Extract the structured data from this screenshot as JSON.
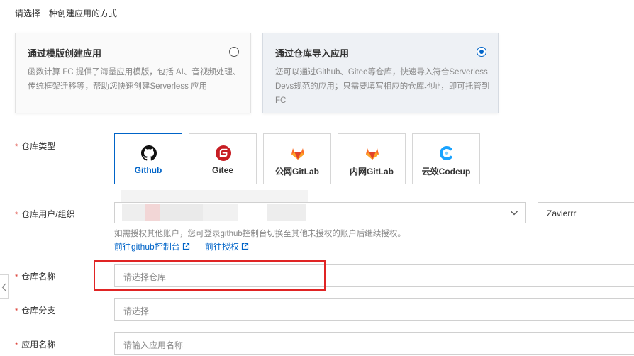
{
  "section_title": "请选择一种创建应用的方式",
  "methods": [
    {
      "title": "通过模版创建应用",
      "description": "函数计算 FC 提供了海量应用模版，包括 AI、音视频处理、传统框架迁移等，帮助您快速创建Serverless 应用",
      "checked": false
    },
    {
      "title": "通过仓库导入应用",
      "description": "您可以通过Github、Gitee等仓库，快速导入符合Serverless Devs规范的应用；只需要填写相应的仓库地址，即可托管到 FC",
      "checked": true
    }
  ],
  "form": {
    "repo_type_label": "仓库类型",
    "repo_types": [
      {
        "name": "Github",
        "icon": "github-icon",
        "selected": true
      },
      {
        "name": "Gitee",
        "icon": "gitee-icon",
        "selected": false
      },
      {
        "name": "公网GitLab",
        "icon": "gitlab-icon",
        "selected": false
      },
      {
        "name": "内网GitLab",
        "icon": "gitlab-icon",
        "selected": false
      },
      {
        "name": "云效Codeup",
        "icon": "codeup-icon",
        "selected": false
      }
    ],
    "owner_label": "仓库用户/组织",
    "owner_value": "Zavierrr",
    "hint": "如需授权其他账户，您可登录github控制台切换至其他未授权的账户后继续授权。",
    "link_console": "前往github控制台",
    "link_authorize": "前往授权",
    "repo_name_label": "仓库名称",
    "repo_name_placeholder": "请选择仓库",
    "branch_label": "仓库分支",
    "branch_placeholder": "请选择",
    "app_name_label": "应用名称",
    "app_name_placeholder": "请输入应用名称",
    "required_mark": "*"
  },
  "colors": {
    "primary": "#0064c8",
    "required": "#d93026",
    "highlight": "#e02424",
    "gitee": "#c71d23",
    "gitlab": "#fc6d26",
    "codeup": "#1aa3ff"
  }
}
